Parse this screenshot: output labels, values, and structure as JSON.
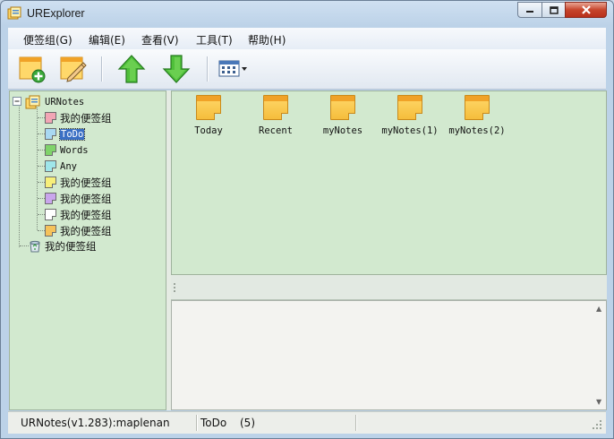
{
  "window": {
    "title": "URExplorer"
  },
  "menu": [
    "便签组(G)",
    "编辑(E)",
    "查看(V)",
    "工具(T)",
    "帮助(H)"
  ],
  "toolbar": {
    "icons": [
      "new-note-group-icon",
      "edit-note-icon",
      "move-up-arrow-icon",
      "move-down-arrow-icon",
      "view-mode-icon"
    ]
  },
  "tree": {
    "root": "URNotes",
    "children": [
      {
        "label": "我的便签组",
        "color": "#f2a6b5"
      },
      {
        "label": "ToDo",
        "color": "#a9d8f2",
        "selected": true
      },
      {
        "label": "Words",
        "color": "#7fd36a"
      },
      {
        "label": "Any",
        "color": "#9fe6ea"
      },
      {
        "label": "我的便签组",
        "color": "#f7ef7a"
      },
      {
        "label": "我的便签组",
        "color": "#c9a6ec"
      },
      {
        "label": "我的便签组",
        "color": "#ffffff"
      },
      {
        "label": "我的便签组",
        "color": "#f5c25b"
      }
    ],
    "recycle": "我的便签组"
  },
  "notes": [
    {
      "label": "Today"
    },
    {
      "label": "Recent"
    },
    {
      "label": "myNotes"
    },
    {
      "label": "myNotes(1)"
    },
    {
      "label": "myNotes(2)"
    }
  ],
  "status": {
    "app": "URNotes(v1.283):maplenan",
    "group": "ToDo",
    "count": "(5)"
  },
  "colors": {
    "pane_bg": "#d2e9cf",
    "selection": "#3a6fc4",
    "note_yellow": "#f5bd3c"
  }
}
